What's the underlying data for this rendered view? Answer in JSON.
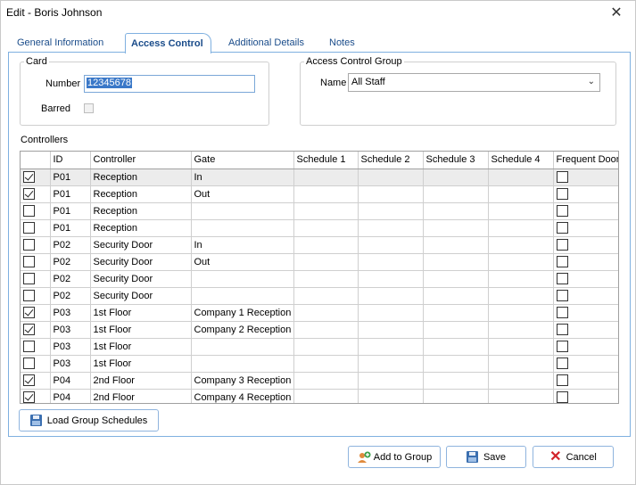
{
  "window": {
    "title": "Edit - Boris Johnson",
    "close_glyph": "✕"
  },
  "tabs": [
    {
      "label": "General Information",
      "active": false
    },
    {
      "label": "Access Control",
      "active": true
    },
    {
      "label": "Additional Details",
      "active": false
    },
    {
      "label": "Notes",
      "active": false
    }
  ],
  "card": {
    "legend": "Card",
    "number_label": "Number",
    "number_value": "12345678",
    "barred_label": "Barred",
    "barred": false
  },
  "access_group": {
    "legend": "Access Control Group",
    "name_label": "Name",
    "name_value": "All Staff"
  },
  "controllers": {
    "label": "Controllers",
    "columns": [
      "",
      "ID",
      "Controller",
      "Gate",
      "Schedule 1",
      "Schedule 2",
      "Schedule 3",
      "Schedule 4",
      "Frequent Door"
    ],
    "rows": [
      {
        "checked": true,
        "id": "P01",
        "controller": "Reception",
        "gate": "In",
        "frequent": false
      },
      {
        "checked": true,
        "id": "P01",
        "controller": "Reception",
        "gate": "Out",
        "frequent": false
      },
      {
        "checked": false,
        "id": "P01",
        "controller": "Reception",
        "gate": "",
        "frequent": false
      },
      {
        "checked": false,
        "id": "P01",
        "controller": "Reception",
        "gate": "",
        "frequent": false
      },
      {
        "checked": false,
        "id": "P02",
        "controller": "Security Door",
        "gate": "In",
        "frequent": false
      },
      {
        "checked": false,
        "id": "P02",
        "controller": "Security Door",
        "gate": "Out",
        "frequent": false
      },
      {
        "checked": false,
        "id": "P02",
        "controller": "Security Door",
        "gate": "",
        "frequent": false
      },
      {
        "checked": false,
        "id": "P02",
        "controller": "Security Door",
        "gate": "",
        "frequent": false
      },
      {
        "checked": true,
        "id": "P03",
        "controller": "1st Floor",
        "gate": "Company 1 Reception",
        "frequent": false
      },
      {
        "checked": true,
        "id": "P03",
        "controller": "1st Floor",
        "gate": "Company 2 Reception",
        "frequent": false
      },
      {
        "checked": false,
        "id": "P03",
        "controller": "1st Floor",
        "gate": "",
        "frequent": false
      },
      {
        "checked": false,
        "id": "P03",
        "controller": "1st Floor",
        "gate": "",
        "frequent": false
      },
      {
        "checked": true,
        "id": "P04",
        "controller": "2nd Floor",
        "gate": "Company 3 Reception",
        "frequent": false
      },
      {
        "checked": true,
        "id": "P04",
        "controller": "2nd Floor",
        "gate": "Company 4 Reception",
        "frequent": false
      }
    ]
  },
  "buttons": {
    "load_group_schedules": "Load Group Schedules",
    "add_to_group": "Add to Group",
    "save": "Save",
    "cancel": "Cancel"
  }
}
